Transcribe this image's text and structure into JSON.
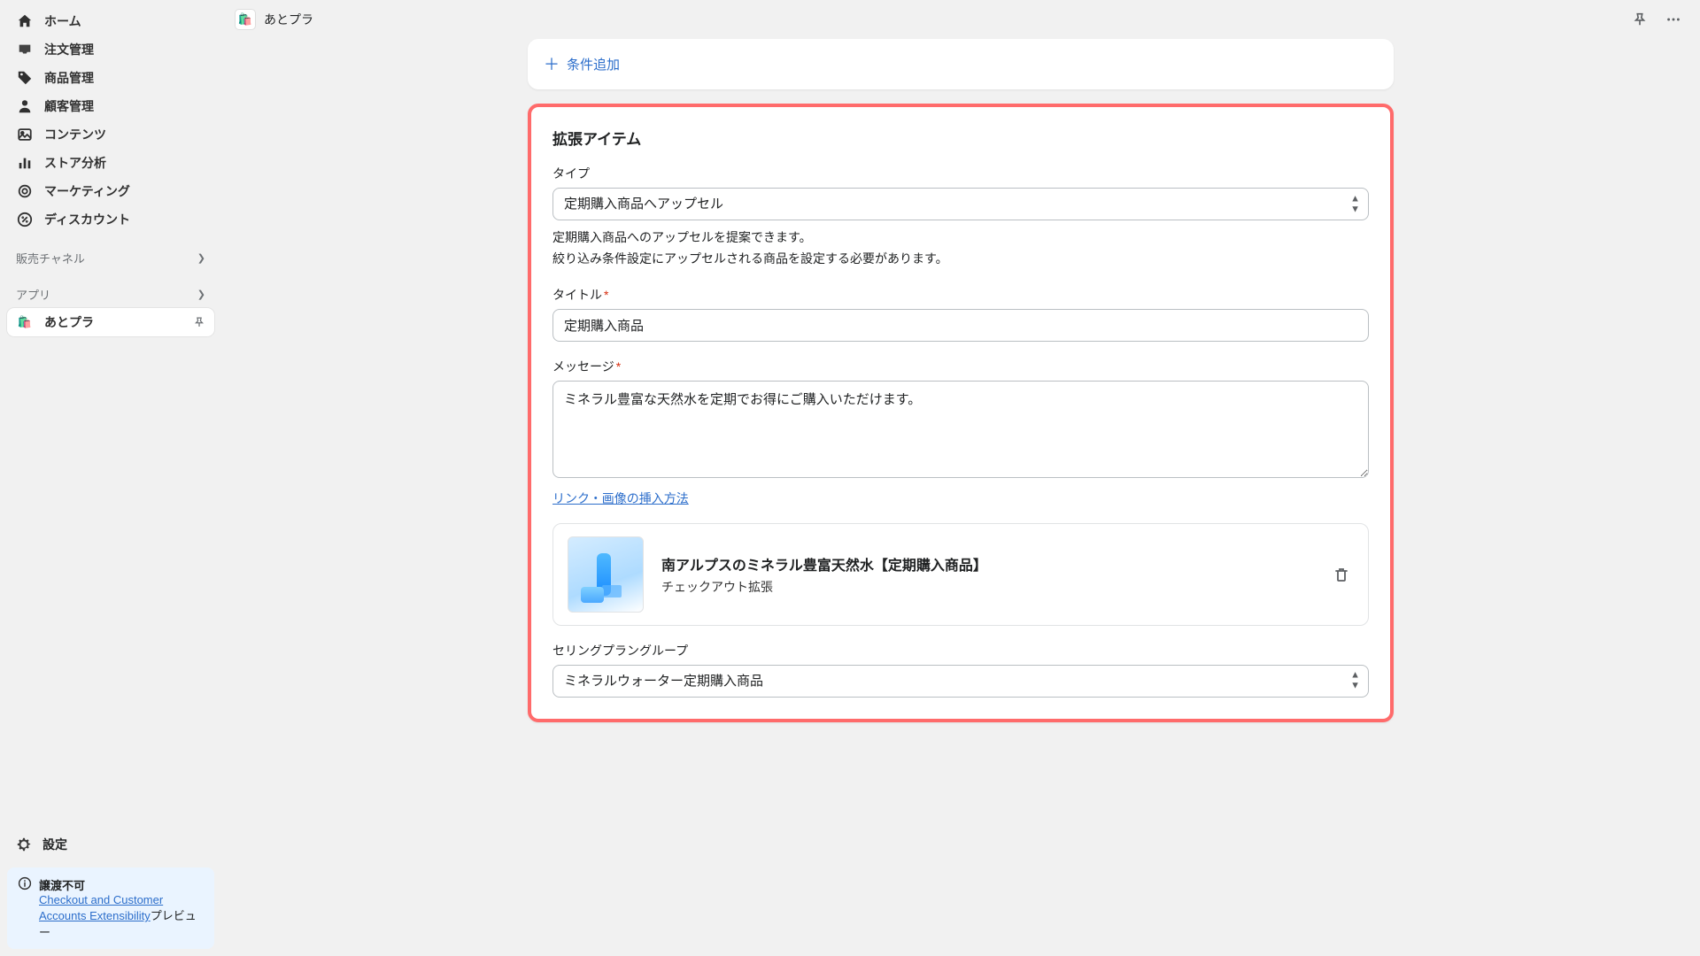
{
  "sidebar": {
    "nav": [
      {
        "label": "ホーム",
        "icon": "home"
      },
      {
        "label": "注文管理",
        "icon": "inbox"
      },
      {
        "label": "商品管理",
        "icon": "tag"
      },
      {
        "label": "顧客管理",
        "icon": "person"
      },
      {
        "label": "コンテンツ",
        "icon": "image"
      },
      {
        "label": "ストア分析",
        "icon": "bars"
      },
      {
        "label": "マーケティング",
        "icon": "target"
      },
      {
        "label": "ディスカウント",
        "icon": "discount"
      }
    ],
    "sales_channels_label": "販売チャネル",
    "apps_label": "アプリ",
    "pinned_app": "あとプラ",
    "settings_label": "設定",
    "notice": {
      "title": "譲渡不可",
      "link_text": "Checkout and Customer Accounts Extensibility",
      "suffix": "プレビュー"
    }
  },
  "topbar": {
    "app_name": "あとプラ"
  },
  "add_condition_label": "条件追加",
  "form": {
    "section_title": "拡張アイテム",
    "type_label": "タイプ",
    "type_value": "定期購入商品へアップセル",
    "type_help_line1": "定期購入商品へのアップセルを提案できます。",
    "type_help_line2": "絞り込み条件設定にアップセルされる商品を設定する必要があります。",
    "title_label": "タイトル",
    "title_value": "定期購入商品",
    "message_label": "メッセージ",
    "message_value": "ミネラル豊富な天然水を定期でお得にご購入いただけます。",
    "insert_link_label": "リンク・画像の挿入方法",
    "product": {
      "name": "南アルプスのミネラル豊富天然水【定期購入商品】",
      "subtitle": "チェックアウト拡張"
    },
    "selling_plan_label": "セリングプラングループ",
    "selling_plan_value": "ミネラルウォーター定期購入商品"
  }
}
